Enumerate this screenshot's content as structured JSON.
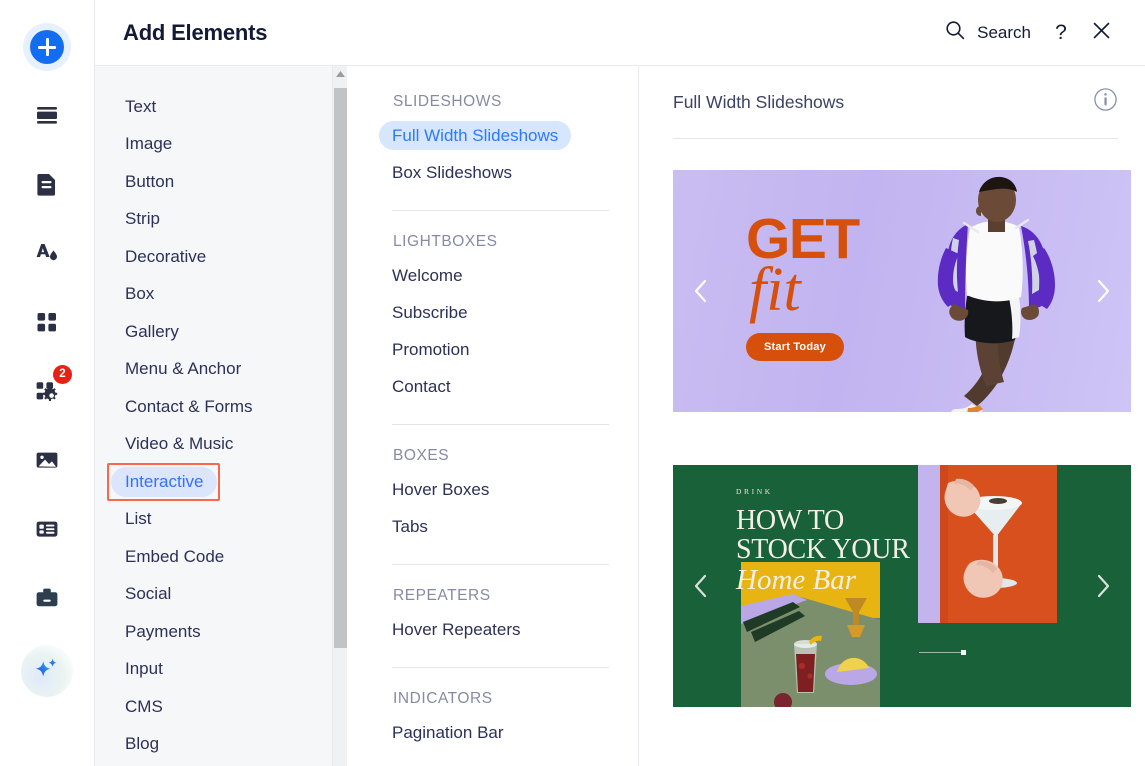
{
  "header": {
    "title": "Add Elements",
    "search_label": "Search",
    "help_label": "?",
    "close_label": "×",
    "search_icon": "search-icon",
    "help_icon": "help-icon",
    "close_icon": "close-icon"
  },
  "rail": {
    "items": [
      {
        "name": "add-elements",
        "icon": "plus-icon",
        "selected": true,
        "badge": null
      },
      {
        "name": "add-section",
        "icon": "sections-icon",
        "selected": false,
        "badge": null
      },
      {
        "name": "pages-menu",
        "icon": "page-icon",
        "selected": false,
        "badge": null
      },
      {
        "name": "site-design",
        "icon": "theme-icon",
        "selected": false,
        "badge": null
      },
      {
        "name": "apps",
        "icon": "apps-grid-icon",
        "selected": false,
        "badge": null
      },
      {
        "name": "add-ons",
        "icon": "puzzle-gear-icon",
        "selected": false,
        "badge": "2"
      },
      {
        "name": "media",
        "icon": "image-icon",
        "selected": false,
        "badge": null
      },
      {
        "name": "cms",
        "icon": "table-icon",
        "selected": false,
        "badge": null
      },
      {
        "name": "business",
        "icon": "briefcase-icon",
        "selected": false,
        "badge": null
      },
      {
        "name": "ai-assistant",
        "icon": "sparkle-icon",
        "selected": false,
        "badge": null
      }
    ]
  },
  "categories": {
    "items": [
      {
        "label": "Text",
        "selected": false
      },
      {
        "label": "Image",
        "selected": false
      },
      {
        "label": "Button",
        "selected": false
      },
      {
        "label": "Strip",
        "selected": false
      },
      {
        "label": "Decorative",
        "selected": false
      },
      {
        "label": "Box",
        "selected": false
      },
      {
        "label": "Gallery",
        "selected": false
      },
      {
        "label": "Menu & Anchor",
        "selected": false
      },
      {
        "label": "Contact & Forms",
        "selected": false
      },
      {
        "label": "Video & Music",
        "selected": false
      },
      {
        "label": "Interactive",
        "selected": true
      },
      {
        "label": "List",
        "selected": false
      },
      {
        "label": "Embed Code",
        "selected": false
      },
      {
        "label": "Social",
        "selected": false
      },
      {
        "label": "Payments",
        "selected": false
      },
      {
        "label": "Input",
        "selected": false
      },
      {
        "label": "CMS",
        "selected": false
      },
      {
        "label": "Blog",
        "selected": false
      }
    ]
  },
  "subcategories": {
    "groups": [
      {
        "heading": "SLIDESHOWS",
        "items": [
          {
            "label": "Full Width Slideshows",
            "selected": true
          },
          {
            "label": "Box Slideshows",
            "selected": false
          }
        ]
      },
      {
        "heading": "LIGHTBOXES",
        "items": [
          {
            "label": "Welcome",
            "selected": false
          },
          {
            "label": "Subscribe",
            "selected": false
          },
          {
            "label": "Promotion",
            "selected": false
          },
          {
            "label": "Contact",
            "selected": false
          }
        ]
      },
      {
        "heading": "BOXES",
        "items": [
          {
            "label": "Hover Boxes",
            "selected": false
          },
          {
            "label": "Tabs",
            "selected": false
          }
        ]
      },
      {
        "heading": "REPEATERS",
        "items": [
          {
            "label": "Hover Repeaters",
            "selected": false
          }
        ]
      },
      {
        "heading": "INDICATORS",
        "items": [
          {
            "label": "Pagination Bar",
            "selected": false
          }
        ]
      }
    ]
  },
  "preview": {
    "title": "Full Width Slideshows",
    "info_icon": "info-icon",
    "cards": [
      {
        "name": "slideshow-preview-get-fit",
        "headline_top": "GET",
        "headline_script": "fit",
        "cta_label": "Start Today",
        "prev_label": "‹",
        "next_label": "›",
        "background_color": "#c6b9f1",
        "accent_color": "#d6500c"
      },
      {
        "name": "slideshow-preview-home-bar",
        "eyebrow": "DRINK",
        "headline_line1": "HOW TO",
        "headline_line2": "STOCK YOUR",
        "headline_script": "Home Bar",
        "prev_label": "‹",
        "next_label": "›",
        "background_color": "#186139",
        "accent_color": "#f3efe4"
      }
    ]
  },
  "colors": {
    "brand_blue": "#136df3",
    "selection_outline": "#f8684b",
    "selected_pill_bg": "#dbe6fd",
    "selected_pill_text": "#3272f6",
    "badge_red": "#e62214",
    "text_primary": "#2c3157",
    "text_muted": "#868aa5"
  }
}
